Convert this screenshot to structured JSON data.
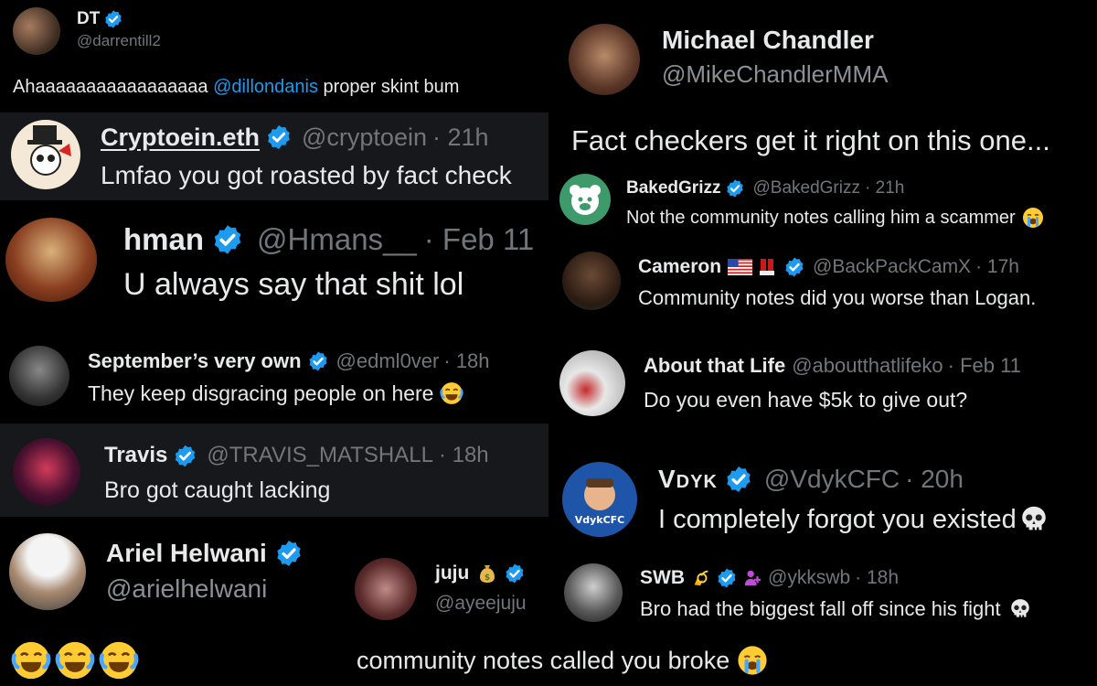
{
  "dt": {
    "name": "DT",
    "handle": "@darrentill2",
    "text_pre": "Ahaaaaaaaaaaaaaaaaa ",
    "mention": "@dillondanis",
    "text_post": " proper skint bum"
  },
  "chandler": {
    "name": "Michael Chandler",
    "handle": "@MikeChandlerMMA",
    "text": "Fact checkers get it right on this one..."
  },
  "cryptoein": {
    "name": "Cryptoein.eth",
    "handle": "@cryptoein",
    "time": "· 21h",
    "text": "Lmfao you got roasted by fact check"
  },
  "hman": {
    "name": "hman",
    "handle": "@Hmans__",
    "time": "· Feb 11",
    "text": "U always say that shit lol"
  },
  "baked": {
    "name": "BakedGrizz",
    "handle": "@BakedGrizz",
    "time": "· 21h",
    "text": "Not the community notes calling him a scammer"
  },
  "cameron": {
    "name": "Cameron",
    "handle": "@BackPackCamX",
    "time": "· 17h",
    "text": "Community notes did you worse than Logan."
  },
  "september": {
    "name": "September’s very own",
    "handle": "@edml0ver",
    "time": "· 18h",
    "text": "They keep disgracing people on here"
  },
  "about": {
    "name": "About that Life",
    "handle": "@aboutthatlifeko",
    "time": "· Feb 11",
    "text": "Do you even have $5k to give out?"
  },
  "travis": {
    "name": "Travis",
    "handle": "@TRAVIS_MATSHALL",
    "time": "· 18h",
    "text": "Bro got caught lacking"
  },
  "vdyk": {
    "name": "Vdyk",
    "handle": "@VdykCFC",
    "time": "· 20h",
    "text": "I completely forgot you existed",
    "avatar_text": "VdykCFC"
  },
  "ariel": {
    "name": "Ariel Helwani",
    "handle": "@arielhelwani"
  },
  "juju": {
    "name": "juju",
    "handle": "@ayeejuju"
  },
  "swb": {
    "name": "SWB",
    "handle": "@ykkswb",
    "time": "· 18h",
    "text": "Bro had the biggest fall off since his fight"
  },
  "bottom": {
    "text": "community notes called you broke"
  },
  "colors": {
    "bg": "#000000",
    "panel": "#16181c",
    "text": "#e7e9ea",
    "muted": "#71767b",
    "link": "#1d9bf0",
    "verified": "#1d9bf0"
  },
  "icons": [
    "verified-badge-icon",
    "crying-laughing-emoji-icon",
    "loudly-crying-emoji-icon",
    "skull-emoji-icon",
    "money-bag-emoji-icon",
    "us-flag-emoji-icon",
    "boxing-glove-emoji-icon",
    "dizzy-emoji-icon",
    "grizzly-logo-icon"
  ]
}
